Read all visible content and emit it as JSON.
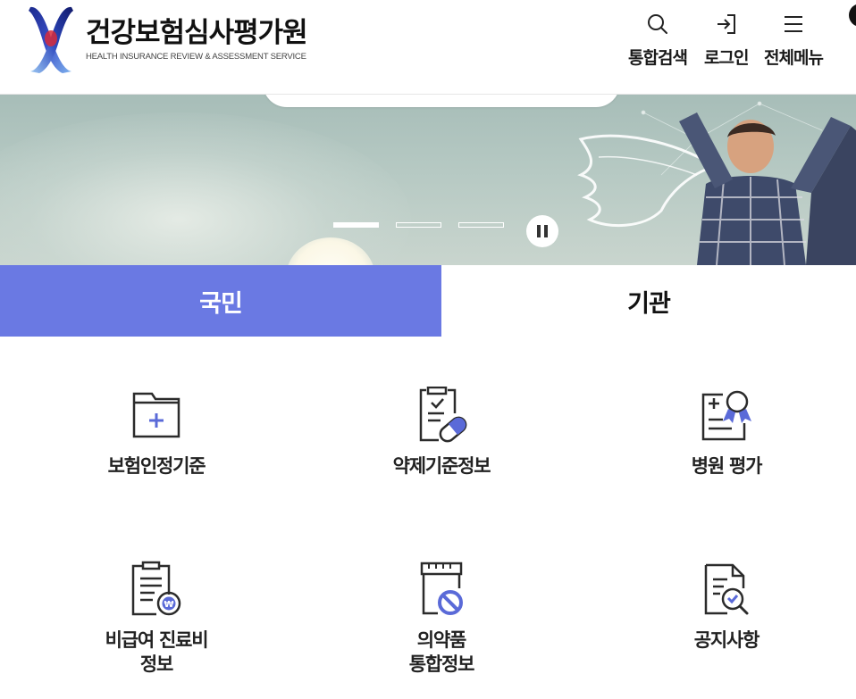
{
  "header": {
    "logo": {
      "name_ko": "건강보험심사평가원",
      "name_en": "HEALTH INSURANCE REVIEW & ASSESSMENT SERVICE"
    },
    "utils": {
      "search_label": "통합검색",
      "login_label": "로그인",
      "menu_label": "전체메뉴"
    }
  },
  "banner": {
    "slide_count": 3,
    "active_slide": 1,
    "pause_icon": "pause-icon"
  },
  "tabs": [
    {
      "label": "국민",
      "active": true
    },
    {
      "label": "기관",
      "active": false
    }
  ],
  "menu_grid": [
    {
      "label": "보험인정기준",
      "icon": "folder-plus-icon"
    },
    {
      "label": "약제기준정보",
      "icon": "clipboard-pill-icon"
    },
    {
      "label": "병원 평가",
      "icon": "clipboard-medal-icon"
    },
    {
      "label_line1": "비급여 진료비",
      "label_line2": "정보",
      "icon": "document-won-icon"
    },
    {
      "label_line1": "의약품",
      "label_line2": "통합정보",
      "icon": "pharmacy-ban-icon"
    },
    {
      "label": "공지사항",
      "icon": "document-search-icon"
    }
  ],
  "colors": {
    "accent": "#6a79e3",
    "icon_dark": "#2b2b2b",
    "icon_accent": "#5a6ad8"
  }
}
